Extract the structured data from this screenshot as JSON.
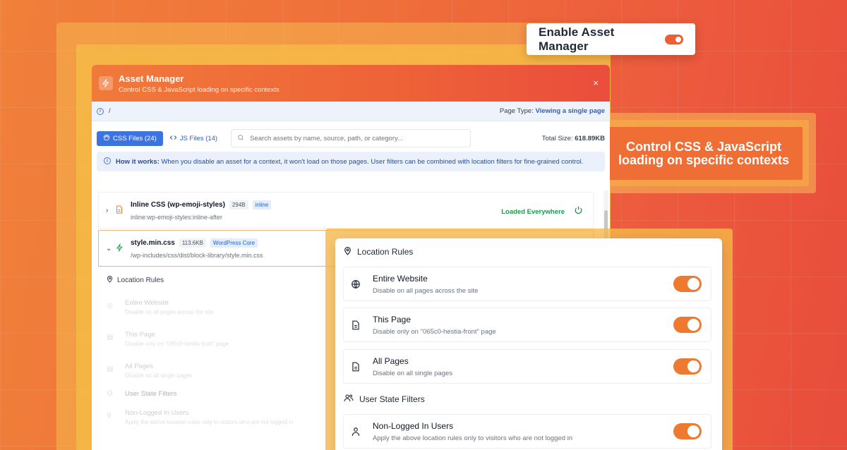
{
  "enable_card": {
    "label": "Enable Asset Manager"
  },
  "promo": {
    "text": "Control CSS & JavaScript loading on specific contexts"
  },
  "modal": {
    "title": "Asset Manager",
    "subtitle": "Control CSS & JavaScript loading on specific contexts",
    "close_label": "×",
    "breadcrumb": "/",
    "page_type_label": "Page Type:",
    "page_type_value": "Viewing a single page",
    "tabs": [
      {
        "label": "CSS Files (24)",
        "icon": "palette-icon"
      },
      {
        "label": "JS Files (14)",
        "icon": "code-icon"
      }
    ],
    "search_placeholder": "Search assets by name, source, path, or category...",
    "total_size_label": "Total Size:",
    "total_size_value": "618.89KB",
    "how_it_works_label": "How it works:",
    "how_it_works_text": "When you disable an asset for a context, it won't load on those pages. User filters can be combined with location filters for fine-grained control.",
    "assets": [
      {
        "name": "Inline CSS (wp-emoji-styles)",
        "size": "294B",
        "tag": "inline",
        "path": "inline:wp-emoji-styles:inline-after",
        "status": "Loaded Everywhere"
      },
      {
        "name": "style.min.css",
        "size": "113.6KB",
        "tag": "WordPress Core",
        "path": "/wp-includes/css/dist/block-library/style.min.css"
      }
    ],
    "faded": {
      "location_rules": "Location Rules",
      "items": [
        {
          "title": "Entire Website",
          "sub": "Disable on all pages across the site"
        },
        {
          "title": "This Page",
          "sub": "Disable only on \"065c0-hestia-front\" page"
        },
        {
          "title": "All Pages",
          "sub": "Disable on all single pages"
        }
      ],
      "user_state": "User State Filters",
      "user_items": [
        {
          "title": "Non-Logged In Users",
          "sub": "Apply the above location rules only to visitors who are not logged in"
        }
      ]
    }
  },
  "location_card": {
    "heading": "Location Rules",
    "rules": [
      {
        "title": "Entire Website",
        "sub": "Disable on all pages across the site",
        "icon": "globe-icon",
        "enabled": true
      },
      {
        "title": "This Page",
        "sub": "Disable only on \"065c0-hestia-front\" page",
        "icon": "document-icon",
        "enabled": true
      },
      {
        "title": "All Pages",
        "sub": "Disable on all single pages",
        "icon": "document-icon",
        "enabled": true
      }
    ],
    "user_heading": "User State Filters",
    "user_rules": [
      {
        "title": "Non-Logged In Users",
        "sub": "Apply the above location rules only to visitors who are not logged in",
        "icon": "user-icon",
        "enabled": true
      }
    ]
  },
  "colors": {
    "accent": "#ee7a2f",
    "blue": "#3b74e0",
    "green": "#1c9c4b"
  }
}
